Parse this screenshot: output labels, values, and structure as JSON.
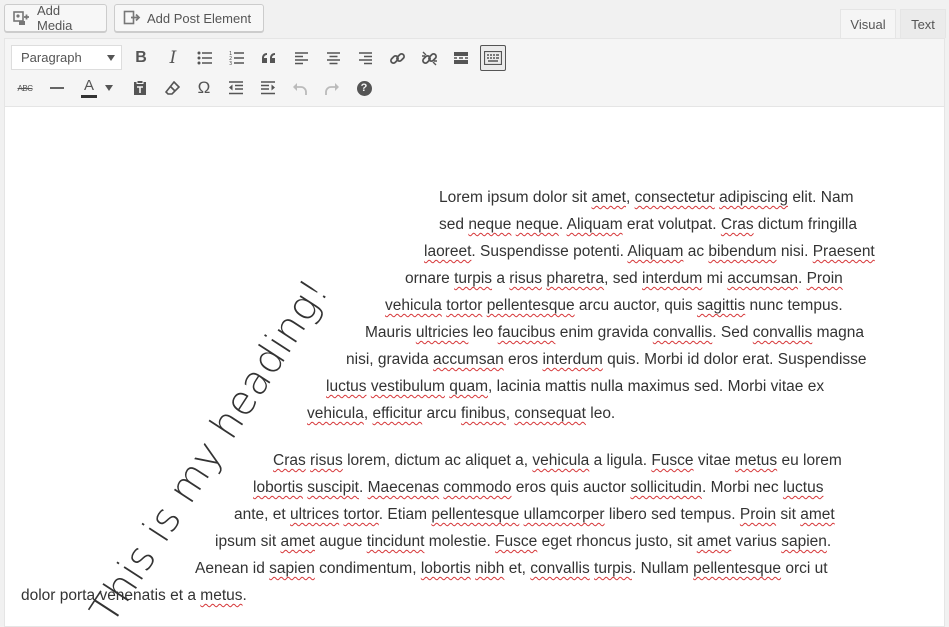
{
  "media_buttons": {
    "add_media": "Add Media",
    "add_post_element": "Add Post Element"
  },
  "tabs": {
    "visual": "Visual",
    "text": "Text",
    "active": "visual"
  },
  "toolbar": {
    "format_select": "Paragraph",
    "row1_icons": [
      "bold",
      "italic",
      "bulleted-list",
      "numbered-list",
      "blockquote",
      "align-left",
      "align-center",
      "align-right",
      "insert-link",
      "remove-link",
      "read-more",
      "toolbar-toggle"
    ],
    "row2_icons": [
      "strikethrough",
      "horizontal-line",
      "text-color",
      "text-color-dropdown",
      "paste-as-text",
      "clear-formatting",
      "special-character",
      "decrease-indent",
      "increase-indent",
      "undo",
      "redo",
      "keyboard-shortcuts"
    ],
    "bold_glyph": "B",
    "italic_glyph": "I",
    "text_color_glyph": "A",
    "special_char_glyph": "Ω",
    "help_glyph": "?",
    "strike_glyph": "ABC"
  },
  "content": {
    "heading": "This is my heading!",
    "paragraph1_lines": [
      "Lorem ipsum dolor sit amet, consectetur adipiscing elit. Nam",
      "sed neque neque. Aliquam erat volutpat. Cras dictum fringilla",
      "laoreet. Suspendisse potenti. Aliquam ac bibendum nisi. Praesent",
      "ornare turpis a risus pharetra, sed interdum mi accumsan. Proin",
      "vehicula tortor pellentesque arcu auctor, quis sagittis nunc tempus.",
      "Mauris ultricies leo faucibus enim gravida convallis. Sed convallis magna",
      "nisi, gravida accumsan eros interdum quis. Morbi id dolor erat. Suspendisse",
      "luctus vestibulum quam, lacinia mattis nulla maximus sed. Morbi vitae ex",
      "vehicula, efficitur arcu finibus, consequat leo."
    ],
    "paragraph2_lines": [
      "Cras risus lorem, dictum ac aliquet a, vehicula a ligula. Fusce vitae metus eu lorem",
      "lobortis suscipit. Maecenas commodo eros quis auctor sollicitudin. Morbi nec luctus",
      "ante, et ultrices tortor. Etiam pellentesque ullamcorper libero sed tempus. Proin sit amet",
      "ipsum sit amet augue tincidunt molestie. Fusce eget rhoncus justo, sit amet varius sapien.",
      "Aenean id sapien condimentum, lobortis nibh et, convallis turpis. Nullam pellentesque orci ut",
      "dolor porta venenatis et a metus."
    ],
    "spellcheck_flagged_words": [
      "amet",
      "consectetur",
      "adipiscing",
      "neque",
      "Aliquam",
      "Cras",
      "laoreet",
      "bibendum",
      "Praesent",
      "turpis",
      "risus",
      "pharetra",
      "interdum",
      "accumsan",
      "Proin",
      "vehicula",
      "tortor",
      "pellentesque",
      "sagittis",
      "ultricies",
      "faucibus",
      "convallis",
      "luctus",
      "vestibulum",
      "quam",
      "efficitur",
      "finibus",
      "consequat",
      "Fusce",
      "metus",
      "lobortis",
      "suscipit",
      "Maecenas",
      "commodo",
      "sollicitudin",
      "ultrices",
      "ullamcorper",
      "tincidunt",
      "sapien",
      "nibh"
    ],
    "colors": {
      "text": "#333333",
      "spellcheck": "#d63638",
      "toolbar_bg": "#f5f5f5",
      "page_bg": "#f1f1f1"
    }
  }
}
